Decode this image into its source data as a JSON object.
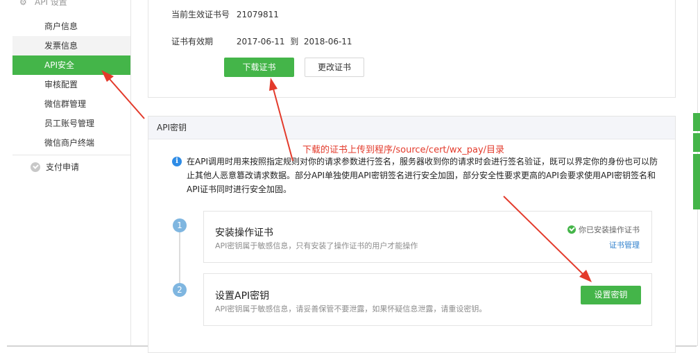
{
  "sidebar": {
    "group_cut": "API 设置",
    "items": [
      {
        "label": "商户信息"
      },
      {
        "label": "发票信息"
      },
      {
        "label": "API安全"
      },
      {
        "label": "审核配置"
      },
      {
        "label": "微信群管理"
      },
      {
        "label": "员工账号管理"
      },
      {
        "label": "微信商户终端"
      }
    ],
    "pay_apply": "支付申请"
  },
  "cert": {
    "number_label": "当前生效证书号",
    "number_value": "21079811",
    "validity_label": "证书有效期",
    "validity_value": "2017-06-11  到  2018-06-11",
    "download_button": "下载证书",
    "change_button": "更改证书"
  },
  "api_key": {
    "header": "API密钥",
    "info_icon_glyph": "i",
    "info_text": "在API调用时用来按照指定规则对你的请求参数进行签名，服务器收到你的请求时会进行签名验证，既可以界定你的身份也可以防止其他人恶意篡改请求数据。部分API单独使用API密钥签名进行安全加固，部分安全性要求更高的API会要求使用API密钥签名和API证书同时进行安全加固。",
    "steps": [
      {
        "number": "1",
        "title": "安装操作证书",
        "desc": "API密钥属于敏感信息，只有安装了操作证书的用户才能操作",
        "status": "你已安装操作证书",
        "link": "证书管理"
      },
      {
        "number": "2",
        "title": "设置API密钥",
        "desc": "API密钥属于敏感信息，请妥善保管不要泄露，如果怀疑信息泄露，请重设密钥。",
        "button": "设置密钥"
      }
    ]
  },
  "annotation": "下载的证书上传到程序/source/cert/wx_pay/目录",
  "colors": {
    "accent_green": "#44b549",
    "annotation_red": "#e33a2b",
    "link_blue": "#2e7fcc",
    "step_blue": "#7fb6e0"
  },
  "icons": [
    "gear-icon",
    "check-circle-icon",
    "info-icon",
    "success-check-icon",
    "red-arrow"
  ]
}
